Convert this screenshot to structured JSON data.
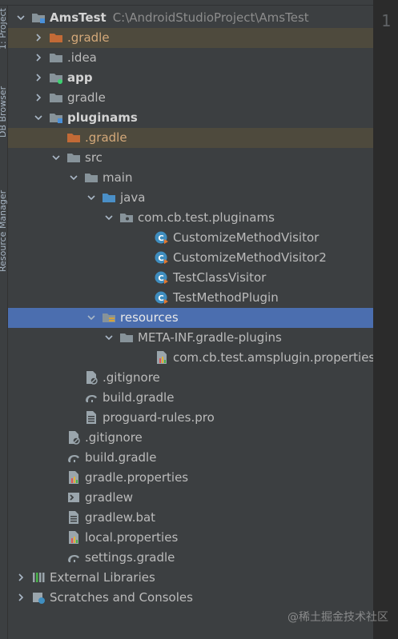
{
  "side_tabs": [
    "1: Project",
    "DB Browser",
    "Resource Manager"
  ],
  "editor": {
    "line_number": "1"
  },
  "watermark": "@稀土掘金技术社区",
  "tree": [
    {
      "label": "AmsTest",
      "path": "C:\\AndroidStudioProject\\AmsTest",
      "icon": "module-folder-icon",
      "arrow": "down",
      "depth": 0,
      "bold": true
    },
    {
      "label": ".gradle",
      "icon": "excluded-folder-icon",
      "arrow": "right",
      "depth": 1,
      "state": "excluded"
    },
    {
      "label": ".idea",
      "icon": "folder-icon",
      "arrow": "right",
      "depth": 1
    },
    {
      "label": "app",
      "icon": "android-module-folder-icon",
      "arrow": "right",
      "depth": 1,
      "bold": true
    },
    {
      "label": "gradle",
      "icon": "folder-icon",
      "arrow": "right",
      "depth": 1
    },
    {
      "label": "pluginams",
      "icon": "module-folder-icon",
      "arrow": "down",
      "depth": 1,
      "bold": true
    },
    {
      "label": ".gradle",
      "icon": "excluded-folder-icon",
      "arrow": "",
      "depth": 2,
      "state": "excluded"
    },
    {
      "label": "src",
      "icon": "folder-icon",
      "arrow": "down",
      "depth": 2
    },
    {
      "label": "main",
      "icon": "folder-icon",
      "arrow": "down",
      "depth": 3
    },
    {
      "label": "java",
      "icon": "source-folder-icon",
      "arrow": "down",
      "depth": 4
    },
    {
      "label": "com.cb.test.pluginams",
      "icon": "package-icon",
      "arrow": "down",
      "depth": 5
    },
    {
      "label": "CustomizeMethodVisitor",
      "icon": "groovy-class-icon",
      "arrow": "",
      "depth": 7
    },
    {
      "label": "CustomizeMethodVisitor2",
      "icon": "groovy-class-icon",
      "arrow": "",
      "depth": 7
    },
    {
      "label": "TestClassVisitor",
      "icon": "groovy-class-icon",
      "arrow": "",
      "depth": 7
    },
    {
      "label": "TestMethodPlugin",
      "icon": "groovy-class-icon",
      "arrow": "",
      "depth": 7
    },
    {
      "label": "resources",
      "icon": "resources-folder-icon",
      "arrow": "down",
      "depth": 4,
      "state": "selected"
    },
    {
      "label": "META-INF.gradle-plugins",
      "icon": "folder-icon",
      "arrow": "down",
      "depth": 5
    },
    {
      "label": "com.cb.test.amsplugin.properties",
      "icon": "properties-file-icon",
      "arrow": "",
      "depth": 7
    },
    {
      "label": ".gitignore",
      "icon": "gitignore-file-icon",
      "arrow": "",
      "depth": 3
    },
    {
      "label": "build.gradle",
      "icon": "gradle-elephant-icon",
      "arrow": "",
      "depth": 3
    },
    {
      "label": "proguard-rules.pro",
      "icon": "text-file-icon",
      "arrow": "",
      "depth": 3
    },
    {
      "label": ".gitignore",
      "icon": "gitignore-file-icon",
      "arrow": "",
      "depth": 2
    },
    {
      "label": "build.gradle",
      "icon": "gradle-elephant-icon",
      "arrow": "",
      "depth": 2
    },
    {
      "label": "gradle.properties",
      "icon": "properties-file-icon",
      "arrow": "",
      "depth": 2
    },
    {
      "label": "gradlew",
      "icon": "shell-script-icon",
      "arrow": "",
      "depth": 2
    },
    {
      "label": "gradlew.bat",
      "icon": "text-file-icon",
      "arrow": "",
      "depth": 2
    },
    {
      "label": "local.properties",
      "icon": "properties-file-icon",
      "arrow": "",
      "depth": 2
    },
    {
      "label": "settings.gradle",
      "icon": "gradle-elephant-icon",
      "arrow": "",
      "depth": 2
    },
    {
      "label": "External Libraries",
      "icon": "libraries-icon",
      "arrow": "right",
      "depth": 0
    },
    {
      "label": "Scratches and Consoles",
      "icon": "scratches-icon",
      "arrow": "right",
      "depth": 0
    }
  ]
}
